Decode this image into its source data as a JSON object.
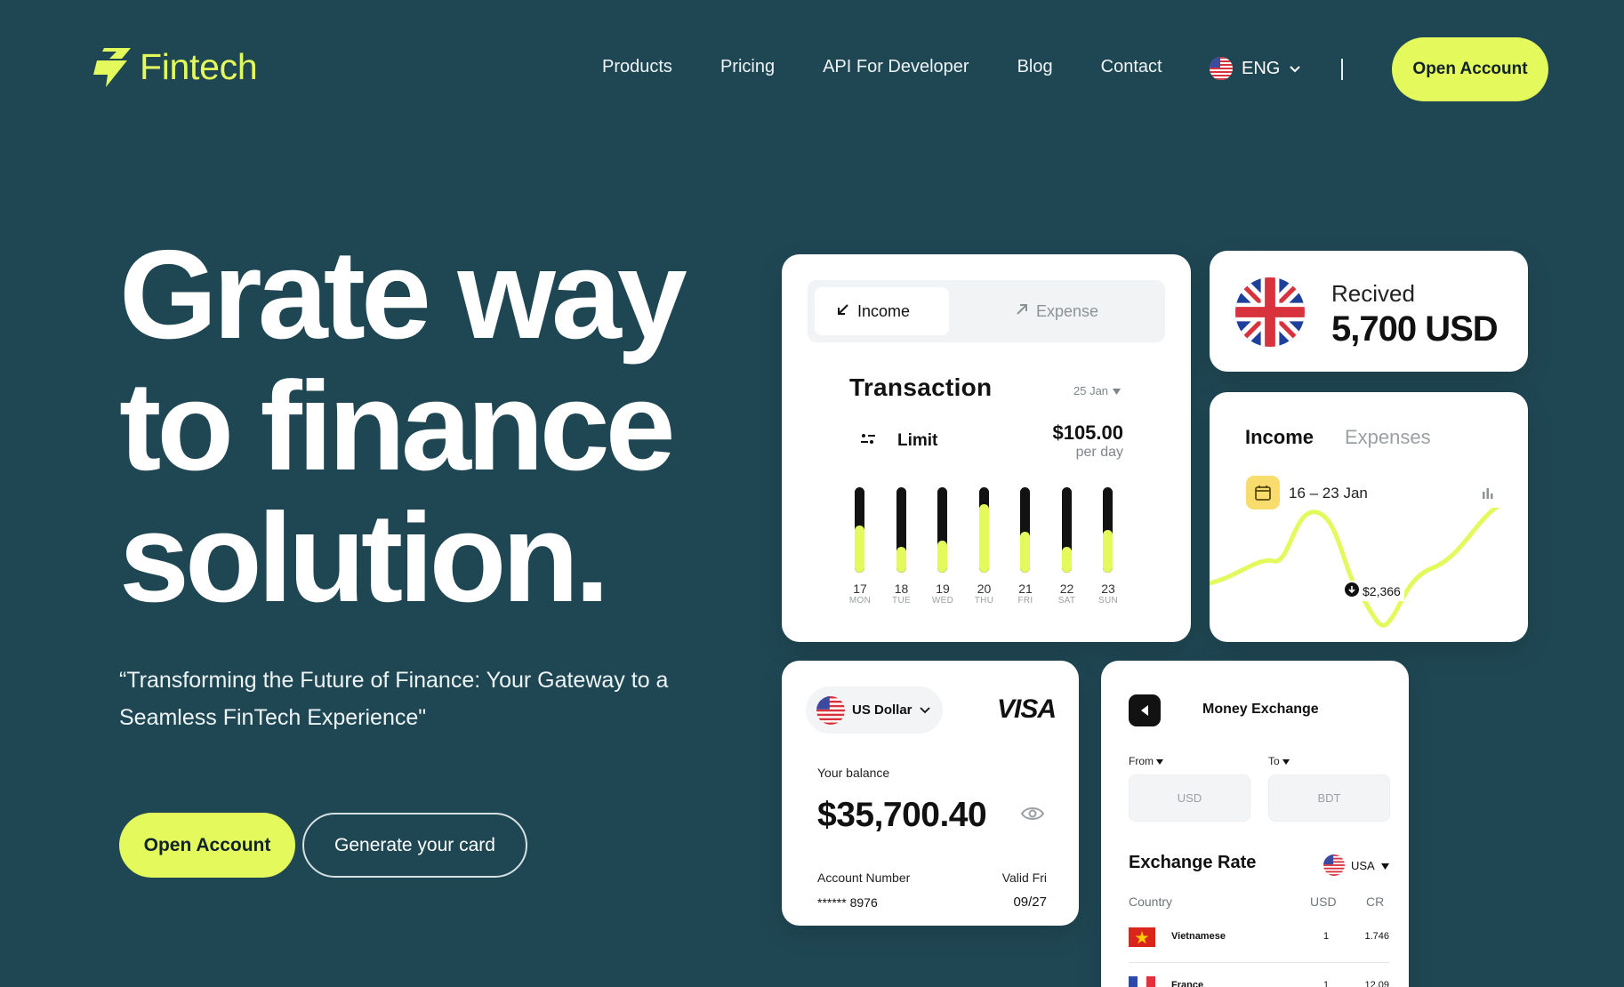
{
  "brand": {
    "name": "Fintech",
    "accent": "#e3f95c",
    "background": "#1f4753"
  },
  "nav": {
    "items": [
      "Products",
      "Pricing",
      "API For Developer",
      "Blog",
      "Contact"
    ],
    "language": "ENG",
    "cta": "Open Account"
  },
  "hero": {
    "title_lines": [
      "Grate way",
      "to finance",
      "solution."
    ],
    "subtitle": "“Transforming the Future of Finance: Your Gateway to a Seamless FinTech Experience\"",
    "cta_primary": "Open Account",
    "cta_secondary": "Generate your card"
  },
  "transaction_card": {
    "tab_income": "Income",
    "tab_expense": "Expense",
    "title": "Transaction",
    "date": "25 Jan",
    "limit_label": "Limit",
    "limit_amount": "$105.00",
    "limit_period": "per day",
    "days": [
      {
        "num": "17",
        "dow": "MON",
        "fill": 0.55
      },
      {
        "num": "18",
        "dow": "TUE",
        "fill": 0.3
      },
      {
        "num": "19",
        "dow": "WED",
        "fill": 0.38
      },
      {
        "num": "20",
        "dow": "THU",
        "fill": 0.8
      },
      {
        "num": "21",
        "dow": "FRI",
        "fill": 0.48
      },
      {
        "num": "22",
        "dow": "SAT",
        "fill": 0.3
      },
      {
        "num": "23",
        "dow": "SUN",
        "fill": 0.5
      }
    ]
  },
  "received_card": {
    "label": "Recived",
    "amount": "5,700 USD"
  },
  "income_card": {
    "tab_income": "Income",
    "tab_expenses": "Expenses",
    "range": "16 – 23 Jan",
    "badge": "$2,366"
  },
  "balance_card": {
    "currency": "US Dollar",
    "brand": "VISA",
    "balance_label": "Your balance",
    "balance": "$35,700.40",
    "account_label": "Account Number",
    "account_number": "****** 8976",
    "valid_label": "Valid Fri",
    "valid_date": "09/27"
  },
  "exchange_card": {
    "title": "Money Exchange",
    "from_label": "From",
    "to_label": "To",
    "from_value": "USD",
    "to_value": "BDT",
    "rate_title": "Exchange Rate",
    "region": "USA",
    "columns": [
      "Country",
      "USD",
      "CR"
    ],
    "rows": [
      {
        "country": "Vietnamese",
        "usd": "1",
        "cr": "1.746"
      },
      {
        "country": "France",
        "usd": "1",
        "cr": "12.09"
      }
    ]
  }
}
